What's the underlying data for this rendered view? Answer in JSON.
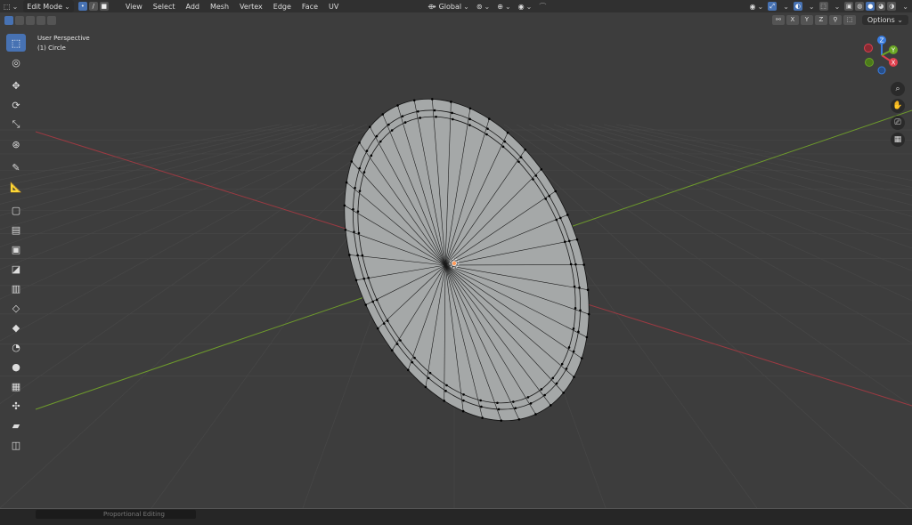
{
  "header": {
    "editor_type_icon": "viewport-icon",
    "mode_label": "Edit Mode",
    "menus": [
      "View",
      "Select",
      "Add",
      "Mesh",
      "Vertex",
      "Edge",
      "Face",
      "UV"
    ],
    "transform_orientation": "Global",
    "accent_color": "#4772b3"
  },
  "header2": {
    "axis_toggles": [
      "X",
      "Y",
      "Z"
    ],
    "options_label": "Options"
  },
  "viewport": {
    "view_label": "User Perspective",
    "object_label": "(1) Circle",
    "background_color": "#3d3d3d",
    "x_axis_color": "#9b3a42",
    "y_axis_color": "#6e9b2c",
    "mesh_fill": "#a5a8a8"
  },
  "gizmo": {
    "z_label": "Z",
    "y_label": "Y",
    "x_label": "X",
    "x_color": "#e0404e",
    "y_color": "#6aa624",
    "z_color": "#3a7de0"
  },
  "toolbar_icons": [
    "select-box-icon",
    "cursor-icon",
    "move-icon",
    "rotate-icon",
    "scale-icon",
    "transform-icon",
    "annotate-icon",
    "measure-icon",
    "add-cube-icon",
    "extrude-icon",
    "inset-icon",
    "bevel-icon",
    "loop-cut-icon",
    "knife-icon",
    "poly-build-icon",
    "spin-icon",
    "smooth-icon",
    "edge-slide-icon",
    "shrink-fatten-icon",
    "shear-icon",
    "rip-icon"
  ],
  "status": {
    "proportional_label": "Proportional Editing"
  }
}
